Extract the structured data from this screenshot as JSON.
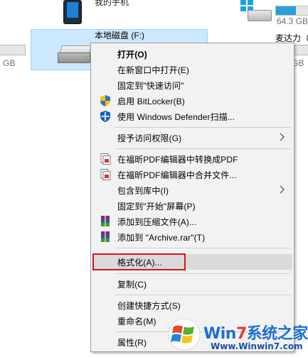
{
  "background": {
    "phone": {
      "label": "我的手机"
    },
    "windows_drive": {
      "size_text": "64.3 GB"
    },
    "left_drive": {
      "size_text": "GB"
    },
    "selected_drive": {
      "label": "本地磁盘 (F:)"
    },
    "right_drive": {
      "label": "麦达力（",
      "size_text": "GB"
    }
  },
  "context_menu": {
    "items": [
      {
        "label": "打开(O)",
        "bold": true
      },
      {
        "label": "在新窗口中打开(E)"
      },
      {
        "label": "固定到\"快速访问\""
      },
      {
        "label": "启用 BitLocker(B)",
        "icon": "shield-uac-icon"
      },
      {
        "label": "使用 Windows Defender扫描...",
        "icon": "windows-defender-icon"
      },
      {
        "label": "授予访问权限(G)",
        "submenu": true
      },
      {
        "label": "在福昕PDF编辑器中转换成PDF",
        "icon": "foxit-pdf-icon"
      },
      {
        "label": "在福昕PDF编辑器中合并文件...",
        "icon": "foxit-pdf-icon"
      },
      {
        "label": "包含到库中(I)",
        "submenu": true
      },
      {
        "label": "固定到\"开始\"屏幕(P)"
      },
      {
        "label": "添加到压缩文件(A)...",
        "icon": "winrar-icon"
      },
      {
        "label": "添加到 \"Archive.rar\"(T)",
        "icon": "winrar-icon"
      },
      {
        "label": "格式化(A)...",
        "state": "hovered-highlighted"
      },
      {
        "label": "复制(C)"
      },
      {
        "label": "创建快捷方式(S)"
      },
      {
        "label": "重命名(M)"
      },
      {
        "label": "属性(R)"
      }
    ]
  },
  "watermark": {
    "title_main": "Win7系统之家",
    "title_accent": "7",
    "url": "Www.Winwin7.com"
  },
  "colors": {
    "selection_fill": "#cce8ff",
    "menu_bg": "#f2f2f2",
    "hover": "#dadada",
    "highlight_border": "#d8141b",
    "watermark_blue": "#1a6fd0"
  }
}
